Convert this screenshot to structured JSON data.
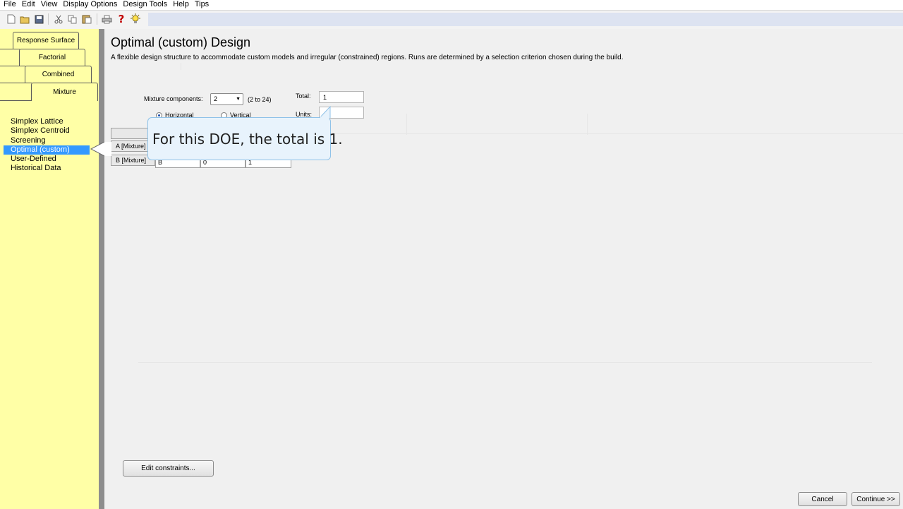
{
  "menu": [
    "File",
    "Edit",
    "View",
    "Display Options",
    "Design Tools",
    "Help",
    "Tips"
  ],
  "toolbar": {
    "icons": [
      "new-file-icon",
      "open-folder-icon",
      "save-icon",
      "cut-icon",
      "copy-icon",
      "paste-icon",
      "print-icon",
      "help-icon",
      "tip-lightbulb-icon"
    ],
    "help_glyph": "?"
  },
  "tabs": [
    "Response Surface",
    "Factorial",
    "Combined",
    "Mixture"
  ],
  "design_list": [
    "Simplex Lattice",
    "Simplex Centroid",
    "Screening",
    "Optimal (custom)",
    "User-Defined",
    "Historical Data"
  ],
  "selected_design_index": 3,
  "title": "Optimal (custom) Design",
  "description": "A flexible design structure to accommodate custom models and irregular (constrained) regions.  Runs are determined by a selection criterion chosen during the build.",
  "form": {
    "mixture_components_label": "Mixture components:",
    "mixture_components_value": "2",
    "mixture_components_range": "(2 to 24)",
    "total_label": "Total:",
    "total_value": "1",
    "units_label": "Units:",
    "units_value": "",
    "orientation_horizontal": "Horizontal",
    "orientation_vertical": "Vertical"
  },
  "grid": {
    "rows": [
      {
        "header": "A [Mixture]",
        "cells": [
          "",
          "",
          ""
        ]
      },
      {
        "header": "B [Mixture]",
        "cells": [
          "B",
          "0",
          "1"
        ]
      }
    ]
  },
  "callout_text": "For this DOE, the total is 1.",
  "buttons": {
    "edit_constraints": "Edit constraints...",
    "cancel": "Cancel",
    "continue": "Continue >>"
  },
  "colors": {
    "panel_yellow": "#ffffa6",
    "selection_blue": "#3399ff",
    "callout_bg": "#e8f3fc",
    "callout_border": "#8fc2e8"
  }
}
